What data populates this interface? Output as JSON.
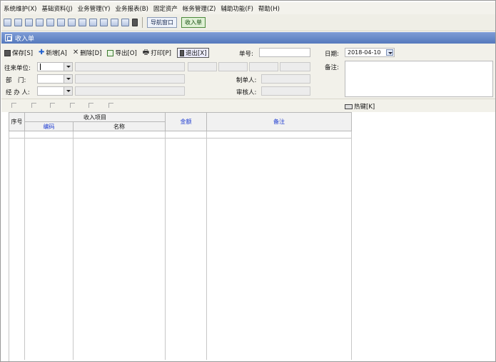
{
  "menubar": {
    "items": [
      "系统维护(X)",
      "基础资料(J)",
      "业务管理(Y)",
      "业务报表(B)",
      "固定资产",
      "帐务管理(Z)",
      "辅助功能(F)",
      "帮助(H)"
    ]
  },
  "toolbar": {
    "icons": [
      "window-icon",
      "list-icon",
      "copy-icon",
      "doc-icon",
      "edit-icon",
      "check-icon",
      "tree-icon",
      "lock-icon",
      "print-icon",
      "save-disk-icon",
      "folder-icon",
      "help-icon",
      "exit-icon"
    ],
    "nav_window_label": "导航窗口",
    "income_tab_label": "收入单"
  },
  "window": {
    "title": "收入单"
  },
  "actions": {
    "save": "保存[S]",
    "new": "新增[A]",
    "delete": "删除[D]",
    "export": "导出[O]",
    "print": "打印[P]",
    "exit": "退出[X]"
  },
  "form": {
    "doc_no_label": "单号:",
    "doc_no_value": "",
    "date_label": "日期:",
    "date_value": "2018-04-10",
    "counterparty_label": "往来单位:",
    "department_label": "部　门:",
    "handler_label": "经 办 人:",
    "remark_label": "备注:",
    "maker_label": "制单人:",
    "reviewer_label": "审核人:"
  },
  "subbar": {
    "hotkey_label": "热键[K]"
  },
  "table": {
    "headers": {
      "seq": "序号",
      "income_item": "收入项目",
      "code": "编码",
      "name": "名称",
      "amount": "金额",
      "remark": "备注"
    }
  }
}
